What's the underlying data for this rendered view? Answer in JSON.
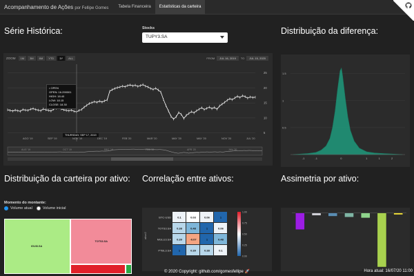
{
  "navbar": {
    "brand": "Acompanhamento de Ações",
    "brand_sub": "por Fellipe Gomes",
    "tabs": [
      {
        "label": "Tabela Financeira",
        "active": false
      },
      {
        "label": "Estatísticas da carteira",
        "active": true
      }
    ]
  },
  "sections": {
    "serie_historica": "Série Histórica:",
    "distribuicao_diferenca": "Distribuição da diferença:",
    "distribuicao_carteira": "Distribuição da carteira por ativo:",
    "correlacao": "Correlação entre ativos:",
    "assimetria": "Assimetria por ativo:"
  },
  "stocks_select": {
    "label": "Stocks",
    "value": "TUPY3.SA"
  },
  "stock_chart": {
    "range_selector": {
      "label": "ZOOM",
      "buttons": [
        "1M",
        "3M",
        "6M",
        "YTD",
        "1Y",
        "ALL"
      ],
      "selected": "1Y"
    },
    "date_range": {
      "from_label": "FROM",
      "from": "JUL 16, 2019",
      "to_label": "TO",
      "to": "JUL 15, 2020"
    },
    "tooltip": {
      "date_line": "• OPEN",
      "lines": [
        "OPEN: 16.290001",
        "HIGH: 18.40",
        "LOW: 18.15",
        "CLOSE: 18.30"
      ]
    },
    "x_flag": "THURSDAY, SEP 17, 2019",
    "x_ticks": [
      "AGO '19",
      "SEP '19",
      "NOV '19",
      "DEC '19",
      "FEB '20",
      "MAR '20",
      "MAY '20",
      "MAY '20",
      "NOV '20",
      "JUL '20"
    ],
    "y_ticks": [
      "25",
      "20",
      "15",
      "10",
      "5"
    ],
    "navigator_ticks": [
      "AUG '19",
      "OCT '19",
      "DEC '19",
      "FEB '20",
      "APR '20",
      "JUN '20"
    ]
  },
  "chart_data": [
    {
      "type": "line",
      "title": "",
      "xlabel": "",
      "ylabel": "",
      "ylim": [
        4,
        27
      ],
      "series": [
        {
          "values": [
            12.7,
            12.5,
            12.3,
            12.6,
            12.4,
            12.2,
            12.8,
            12.6,
            12.5,
            12.9,
            13.1,
            12.8,
            12.6,
            12.4,
            13.0,
            12.7,
            12.5,
            12.3,
            12.9,
            13.2,
            13.4,
            13.0,
            12.7,
            12.5,
            12.4,
            12.6,
            12.2,
            12.0,
            12.5,
            12.8,
            13.6,
            14.2,
            14.8,
            15.1,
            15.4,
            15.2,
            15.6,
            15.3,
            15.7,
            16.0,
            18.9,
            19.4,
            19.8,
            20.1,
            20.3,
            20.6,
            20.4,
            20.8,
            21.0,
            20.7,
            20.9,
            20.5,
            20.8,
            21.1,
            20.6,
            20.3,
            19.8,
            19.5,
            19.9,
            19.3,
            18.6,
            16.2,
            14.1,
            12.3,
            10.5,
            9.6,
            10.4,
            11.8,
            11.2,
            9.8,
            10.9,
            11.5,
            12.1,
            11.7,
            12.4,
            12.9,
            13.4,
            12.8,
            13.2,
            13.6,
            13.1,
            13.5,
            12.9,
            14.0,
            14.6,
            15.2,
            15.9,
            16.4,
            16.1,
            16.7,
            17.2,
            16.8,
            17.4,
            17.1,
            16.6,
            17.0,
            16.8,
            16.9
          ]
        }
      ]
    },
    {
      "type": "area",
      "title": "",
      "x_ticks": [
        "-1",
        "-1",
        "0",
        "1",
        "1",
        "2"
      ],
      "y_ticks": [
        "1.5",
        "1",
        "0.5"
      ],
      "x": [
        -1.9,
        -1.6,
        -1.3,
        -1.0,
        -0.8,
        -0.6,
        -0.45,
        -0.35,
        -0.25,
        -0.15,
        -0.05,
        0.0,
        0.05,
        0.15,
        0.25,
        0.35,
        0.5,
        0.7,
        1.0,
        1.3,
        1.6,
        2.0,
        2.4
      ],
      "values": [
        0.0,
        0.01,
        0.02,
        0.04,
        0.08,
        0.16,
        0.3,
        0.5,
        0.8,
        1.2,
        1.55,
        1.6,
        1.45,
        1.05,
        0.7,
        0.45,
        0.25,
        0.12,
        0.05,
        0.03,
        0.02,
        0.01,
        0.0
      ],
      "xlim": [
        -2,
        2.5
      ],
      "ylim": [
        0,
        1.7
      ]
    },
    {
      "type": "heatmap",
      "title": "",
      "ylabel": "ativo2",
      "rows": [
        "BTC-USD",
        "TOTS3.SA",
        "MGLU3.SA",
        "PTBL3.SA"
      ],
      "cols": [
        "BTC-USD",
        "TOTS3.SA",
        "MGLU3.SA",
        "PTBL3.SA"
      ],
      "cells": [
        [
          "0.1",
          "0.03",
          "0.06",
          "1"
        ],
        [
          "0.38",
          "0.48",
          "1",
          "0.06"
        ],
        [
          "0.39",
          "-0.07",
          "1",
          "0.48"
        ],
        [
          "1",
          "0.39",
          "0.38",
          "0.1"
        ]
      ],
      "scale_ticks": [
        "1.00",
        "0.75",
        "0.50",
        "0.25",
        "0.00"
      ]
    },
    {
      "type": "bar",
      "title": "",
      "values": [
        -2.0,
        -0.3,
        -0.4,
        -0.5,
        -0.6,
        -6.5,
        -0.2
      ],
      "colors": [
        "#9c1de4",
        "#cfcfd6",
        "#5a8db3",
        "#7fb5a4",
        "#8fd48c",
        "#a8d14e",
        "#f5e33a"
      ],
      "ylim": [
        -7,
        0.3
      ]
    }
  ],
  "treemap": {
    "label": "Momento do montante:",
    "options": [
      {
        "label": "Volume atual",
        "selected": true
      },
      {
        "label": "Volume inicial",
        "selected": false
      }
    ],
    "tiles": [
      {
        "label": "IGUI3.SA",
        "value": 52,
        "color": "#abeb85"
      },
      {
        "label": "TOTS3.SA",
        "value": 35,
        "color": "#f28b99"
      },
      {
        "label": "",
        "value": 4,
        "color": "#e0202a"
      },
      {
        "label": "",
        "value": 1,
        "color": "#2aa845"
      }
    ]
  },
  "footer": {
    "copyright": "© 2020 Copyright: github.com/gomesfellipe",
    "time": "Hora atual: 16/07/20 11:00"
  }
}
